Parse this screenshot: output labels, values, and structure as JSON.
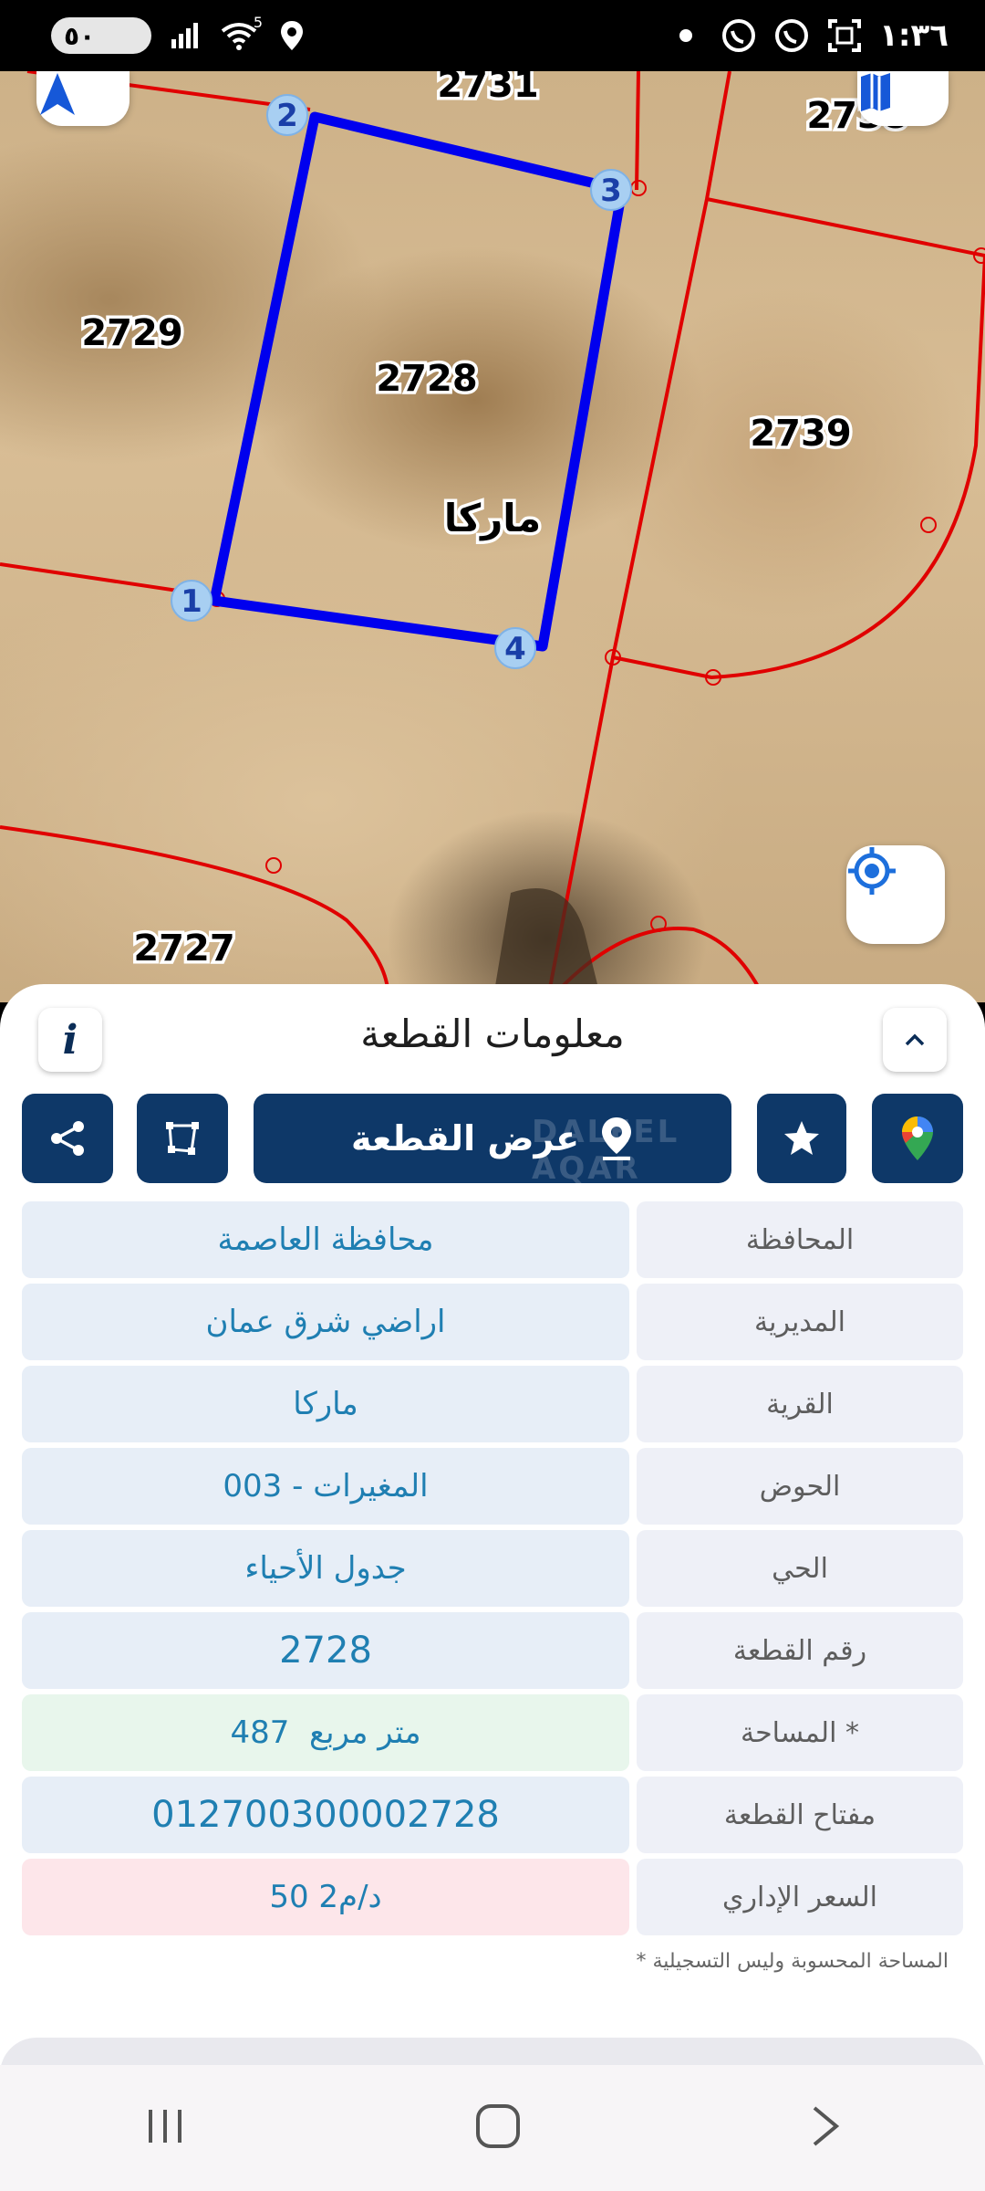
{
  "status_bar": {
    "battery": "٥٠",
    "time": "١:٣٦",
    "wifi_badge": "5"
  },
  "map": {
    "parcels": [
      {
        "label": "2731"
      },
      {
        "label": "2738"
      },
      {
        "label": "2729"
      },
      {
        "label": "2728"
      },
      {
        "label": "2739"
      },
      {
        "label": "2727"
      }
    ],
    "area_name": "ماركا",
    "vertices": [
      "1",
      "2",
      "3",
      "4"
    ]
  },
  "sheet": {
    "title": "معلومات القطعة",
    "info_icon": "i",
    "view_plot_label": "عرض القطعة",
    "watermark": "DALEEL AQAR",
    "rows": [
      {
        "label": "المحافظة",
        "value": "محافظة العاصمة"
      },
      {
        "label": "المديرية",
        "value": "اراضي شرق عمان"
      },
      {
        "label": "القرية",
        "value": "ماركا"
      },
      {
        "label": "الحوض",
        "value": "المغيرات - 003"
      },
      {
        "label": "الحي",
        "value": "جدول الأحياء"
      },
      {
        "label": "رقم القطعة",
        "value": "2728"
      },
      {
        "label": "المساحة *",
        "value": "487  متر مربع"
      },
      {
        "label": "مفتاح القطعة",
        "value": "012700300002728"
      },
      {
        "label": "السعر الإداري",
        "value": "50 د/م2"
      }
    ],
    "footnote": "* المساحة المحسوبة وليس التسجيلية"
  },
  "colors": {
    "primary": "#0e3868",
    "value_text": "#1f7fb2",
    "parcel_border": "#e00000",
    "selected_border": "#0000ee"
  }
}
